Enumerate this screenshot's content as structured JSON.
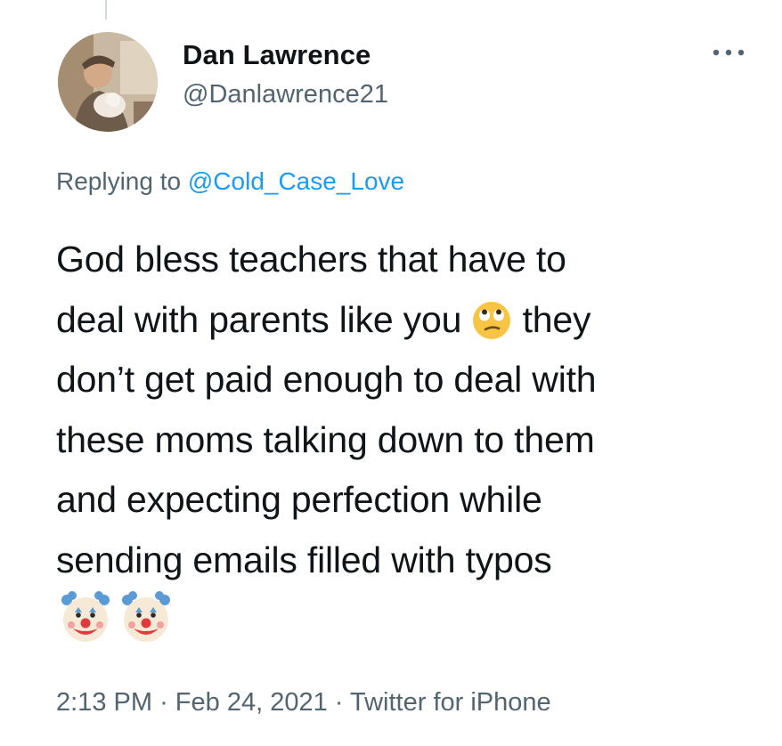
{
  "author": {
    "display_name": "Dan Lawrence",
    "handle": "@Danlawrence21"
  },
  "reply_context": {
    "prefix": "Replying to",
    "mention": "@Cold_Case_Love"
  },
  "tweet": {
    "lines": [
      "God bless teachers that have to",
      "deal with parents like you",
      "they",
      "don’t get paid enough to deal with",
      "these moms talking down to them",
      "and expecting perfection while",
      "sending emails filled with typos"
    ],
    "inline_emoji": "face-with-rolling-eyes",
    "trailing_emoji": [
      "clown-face",
      "clown-face"
    ]
  },
  "meta": {
    "time": "2:13 PM",
    "separator": "·",
    "date": "Feb 24, 2021",
    "source": "Twitter for iPhone"
  },
  "icons": {
    "more": "more-options-icon"
  },
  "colors": {
    "text": "#0f1419",
    "secondary": "#536471",
    "link": "#1d9bf0"
  }
}
